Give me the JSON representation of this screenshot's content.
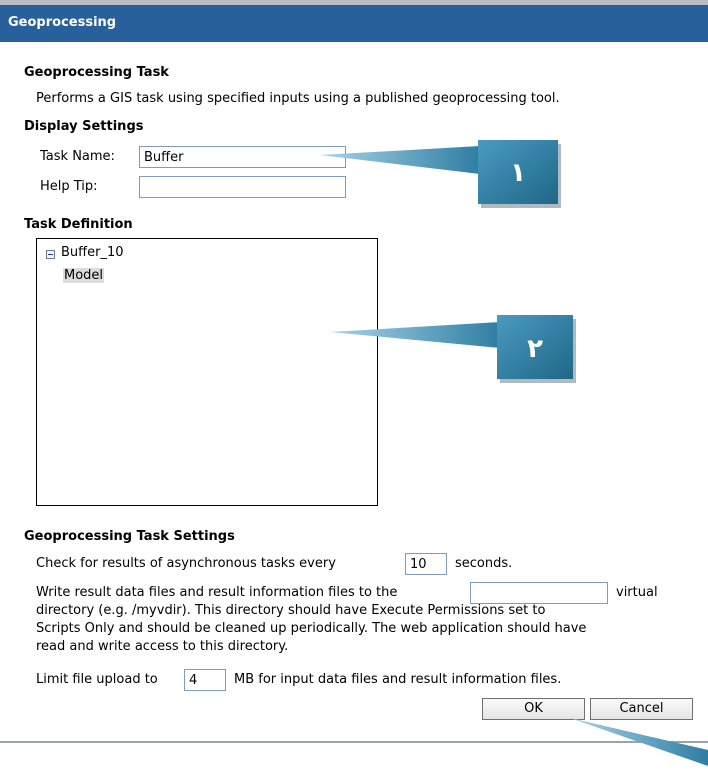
{
  "window": {
    "title": "Geoprocessing"
  },
  "task": {
    "heading": "Geoprocessing Task",
    "description": "Performs a GIS task using specified inputs using a published geoprocessing tool."
  },
  "display_settings": {
    "heading": "Display Settings",
    "task_name_label": "Task Name:",
    "task_name_value": "Buffer",
    "help_tip_label": "Help Tip:",
    "help_tip_value": ""
  },
  "task_definition": {
    "heading": "Task Definition",
    "root_node": "Buffer_10",
    "child_node": "Model"
  },
  "settings": {
    "heading": "Geoprocessing Task Settings",
    "async_prefix": "Check for results of asynchronous tasks every",
    "async_value": "10",
    "async_suffix": "seconds.",
    "write_prefix": "Write result data files and result information files to the",
    "write_value": "",
    "write_suffix": "virtual",
    "write_line2": "directory (e.g. /myvdir). This directory should have Execute Permissions set to",
    "write_line3": "Scripts Only and should be cleaned up periodically. The web application should have",
    "write_line4": "read and write access to this directory.",
    "limit_prefix": "Limit file upload to",
    "limit_value": "4",
    "limit_suffix": "MB for input data files and result information files."
  },
  "buttons": {
    "ok": "OK",
    "cancel": "Cancel"
  },
  "callouts": {
    "one": "١",
    "two": "٢"
  },
  "colors": {
    "titlebar": "#27609a",
    "callout_box": "#2e7ea3",
    "callout_pointer": "#3b8bb2"
  }
}
